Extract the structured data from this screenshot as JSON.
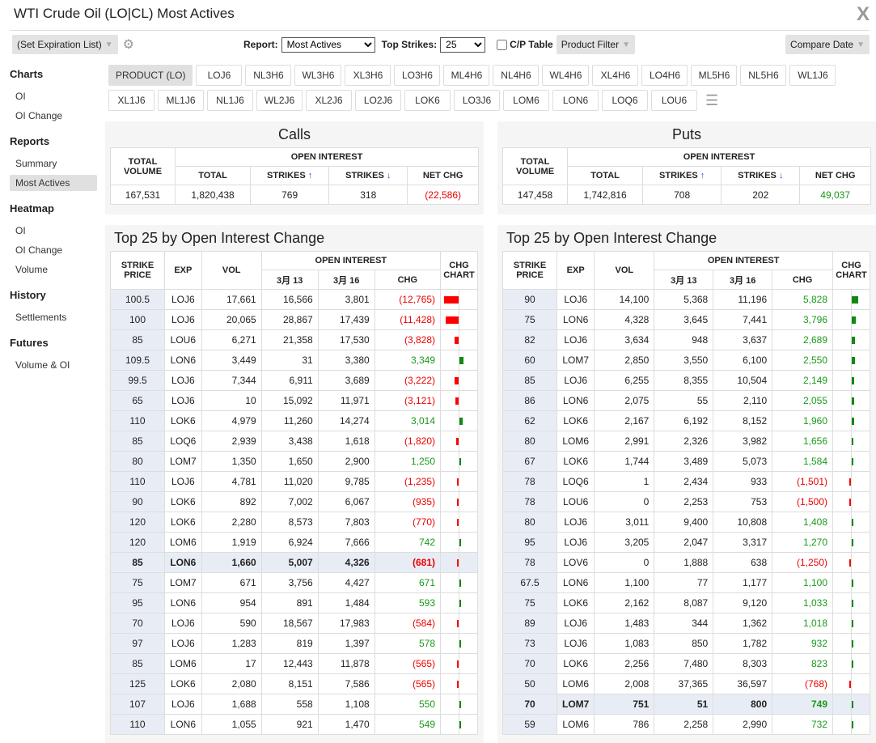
{
  "header": {
    "title": "WTI Crude Oil (LO|CL) Most Actives",
    "logo": "X"
  },
  "toolbar": {
    "expiration": "(Set Expiration List)",
    "report_label": "Report:",
    "report_value": "Most Actives",
    "top_strikes_label": "Top Strikes:",
    "top_strikes_value": "25",
    "cp_table": "C/P Table",
    "product_filter": "Product Filter",
    "compare_date": "Compare Date"
  },
  "sidebar": [
    {
      "title": "Charts",
      "items": [
        "OI",
        "OI Change"
      ]
    },
    {
      "title": "Reports",
      "items": [
        "Summary",
        "Most Actives"
      ]
    },
    {
      "title": "Heatmap",
      "items": [
        "OI",
        "OI Change",
        "Volume"
      ]
    },
    {
      "title": "History",
      "items": [
        "Settlements"
      ]
    },
    {
      "title": "Futures",
      "items": [
        "Volume & OI"
      ]
    }
  ],
  "sidebar_selected": "Most Actives",
  "products": {
    "main": "PRODUCT (LO)",
    "row1": [
      "LOJ6",
      "NL3H6",
      "WL3H6",
      "XL3H6",
      "LO3H6",
      "ML4H6",
      "NL4H6",
      "WL4H6",
      "XL4H6",
      "LO4H6",
      "ML5H6",
      "NL5H6",
      "WL1J6"
    ],
    "row2": [
      "XL1J6",
      "ML1J6",
      "NL1J6",
      "WL2J6",
      "XL2J6",
      "LO2J6",
      "LOK6",
      "LO3J6",
      "LOM6",
      "LON6",
      "LOQ6",
      "LOU6"
    ]
  },
  "summary_headers": {
    "total_volume": "TOTAL VOLUME",
    "open_interest": "OPEN INTEREST",
    "total": "TOTAL",
    "strikes_up": "STRIKES",
    "strikes_down": "STRIKES",
    "up_arrow": "↑",
    "down_arrow": "↓",
    "net_chg": "NET CHG"
  },
  "calls": {
    "title": "Calls",
    "total_volume": "167,531",
    "total_oi": "1,820,438",
    "strikes_up": "769",
    "strikes_down": "318",
    "net_chg": "(22,586)"
  },
  "puts": {
    "title": "Puts",
    "total_volume": "147,458",
    "total_oi": "1,742,816",
    "strikes_up": "708",
    "strikes_down": "202",
    "net_chg": "49,037"
  },
  "top_headers": {
    "title": "Top 25 by Open Interest Change",
    "strike": "STRIKE PRICE",
    "exp": "EXP",
    "vol": "VOL",
    "open_interest": "OPEN INTEREST",
    "d1": "3月 13",
    "d2": "3月 16",
    "chg": "CHG",
    "chart": "CHG CHART"
  },
  "colors": {
    "negative": "#ee0000",
    "positive": "#1a9a1a",
    "bar_negative": "#ff0000",
    "bar_positive": "#118811"
  },
  "top_calls": [
    [
      "100.5",
      "LOJ6",
      "17,661",
      "16,566",
      "3,801",
      -12765
    ],
    [
      "100",
      "LOJ6",
      "20,065",
      "28,867",
      "17,439",
      -11428
    ],
    [
      "85",
      "LOU6",
      "6,271",
      "21,358",
      "17,530",
      -3828
    ],
    [
      "109.5",
      "LON6",
      "3,449",
      "31",
      "3,380",
      3349
    ],
    [
      "99.5",
      "LOJ6",
      "7,344",
      "6,911",
      "3,689",
      -3222
    ],
    [
      "65",
      "LOJ6",
      "10",
      "15,092",
      "11,971",
      -3121
    ],
    [
      "110",
      "LOK6",
      "4,979",
      "11,260",
      "14,274",
      3014
    ],
    [
      "85",
      "LOQ6",
      "2,939",
      "3,438",
      "1,618",
      -1820
    ],
    [
      "80",
      "LOM7",
      "1,350",
      "1,650",
      "2,900",
      1250
    ],
    [
      "110",
      "LOJ6",
      "4,781",
      "11,020",
      "9,785",
      -1235
    ],
    [
      "90",
      "LOK6",
      "892",
      "7,002",
      "6,067",
      -935
    ],
    [
      "120",
      "LOK6",
      "2,280",
      "8,573",
      "7,803",
      -770
    ],
    [
      "120",
      "LOM6",
      "1,919",
      "6,924",
      "7,666",
      742
    ],
    [
      "85",
      "LON6",
      "1,660",
      "5,007",
      "4,326",
      -681
    ],
    [
      "75",
      "LOM7",
      "671",
      "3,756",
      "4,427",
      671
    ],
    [
      "95",
      "LON6",
      "954",
      "891",
      "1,484",
      593
    ],
    [
      "70",
      "LOJ6",
      "590",
      "18,567",
      "17,983",
      -584
    ],
    [
      "97",
      "LOJ6",
      "1,283",
      "819",
      "1,397",
      578
    ],
    [
      "85",
      "LOM6",
      "17",
      "12,443",
      "11,878",
      -565
    ],
    [
      "125",
      "LOK6",
      "2,080",
      "8,151",
      "7,586",
      -565
    ],
    [
      "107",
      "LOJ6",
      "1,688",
      "558",
      "1,108",
      550
    ],
    [
      "110",
      "LON6",
      "1,055",
      "921",
      "1,470",
      549
    ]
  ],
  "top_calls_highlight": 13,
  "top_puts": [
    [
      "90",
      "LOJ6",
      "14,100",
      "5,368",
      "11,196",
      5828
    ],
    [
      "75",
      "LON6",
      "4,328",
      "3,645",
      "7,441",
      3796
    ],
    [
      "82",
      "LOJ6",
      "3,634",
      "948",
      "3,637",
      2689
    ],
    [
      "60",
      "LOM7",
      "2,850",
      "3,550",
      "6,100",
      2550
    ],
    [
      "85",
      "LOJ6",
      "6,255",
      "8,355",
      "10,504",
      2149
    ],
    [
      "86",
      "LON6",
      "2,075",
      "55",
      "2,110",
      2055
    ],
    [
      "62",
      "LOK6",
      "2,167",
      "6,192",
      "8,152",
      1960
    ],
    [
      "80",
      "LOM6",
      "2,991",
      "2,326",
      "3,982",
      1656
    ],
    [
      "67",
      "LOK6",
      "1,744",
      "3,489",
      "5,073",
      1584
    ],
    [
      "78",
      "LOQ6",
      "1",
      "2,434",
      "933",
      -1501
    ],
    [
      "78",
      "LOU6",
      "0",
      "2,253",
      "753",
      -1500
    ],
    [
      "80",
      "LOJ6",
      "3,011",
      "9,400",
      "10,808",
      1408
    ],
    [
      "95",
      "LOJ6",
      "3,205",
      "2,047",
      "3,317",
      1270
    ],
    [
      "78",
      "LOV6",
      "0",
      "1,888",
      "638",
      -1250
    ],
    [
      "67.5",
      "LON6",
      "1,100",
      "77",
      "1,177",
      1100
    ],
    [
      "75",
      "LOK6",
      "2,162",
      "8,087",
      "9,120",
      1033
    ],
    [
      "89",
      "LOJ6",
      "1,483",
      "344",
      "1,362",
      1018
    ],
    [
      "73",
      "LOJ6",
      "1,083",
      "850",
      "1,782",
      932
    ],
    [
      "70",
      "LOK6",
      "2,256",
      "7,480",
      "8,303",
      823
    ],
    [
      "50",
      "LOM6",
      "2,008",
      "37,365",
      "36,597",
      -768
    ],
    [
      "70",
      "LOM7",
      "751",
      "51",
      "800",
      749
    ],
    [
      "59",
      "LOM6",
      "786",
      "2,258",
      "2,990",
      732
    ]
  ],
  "top_puts_highlight": 20
}
